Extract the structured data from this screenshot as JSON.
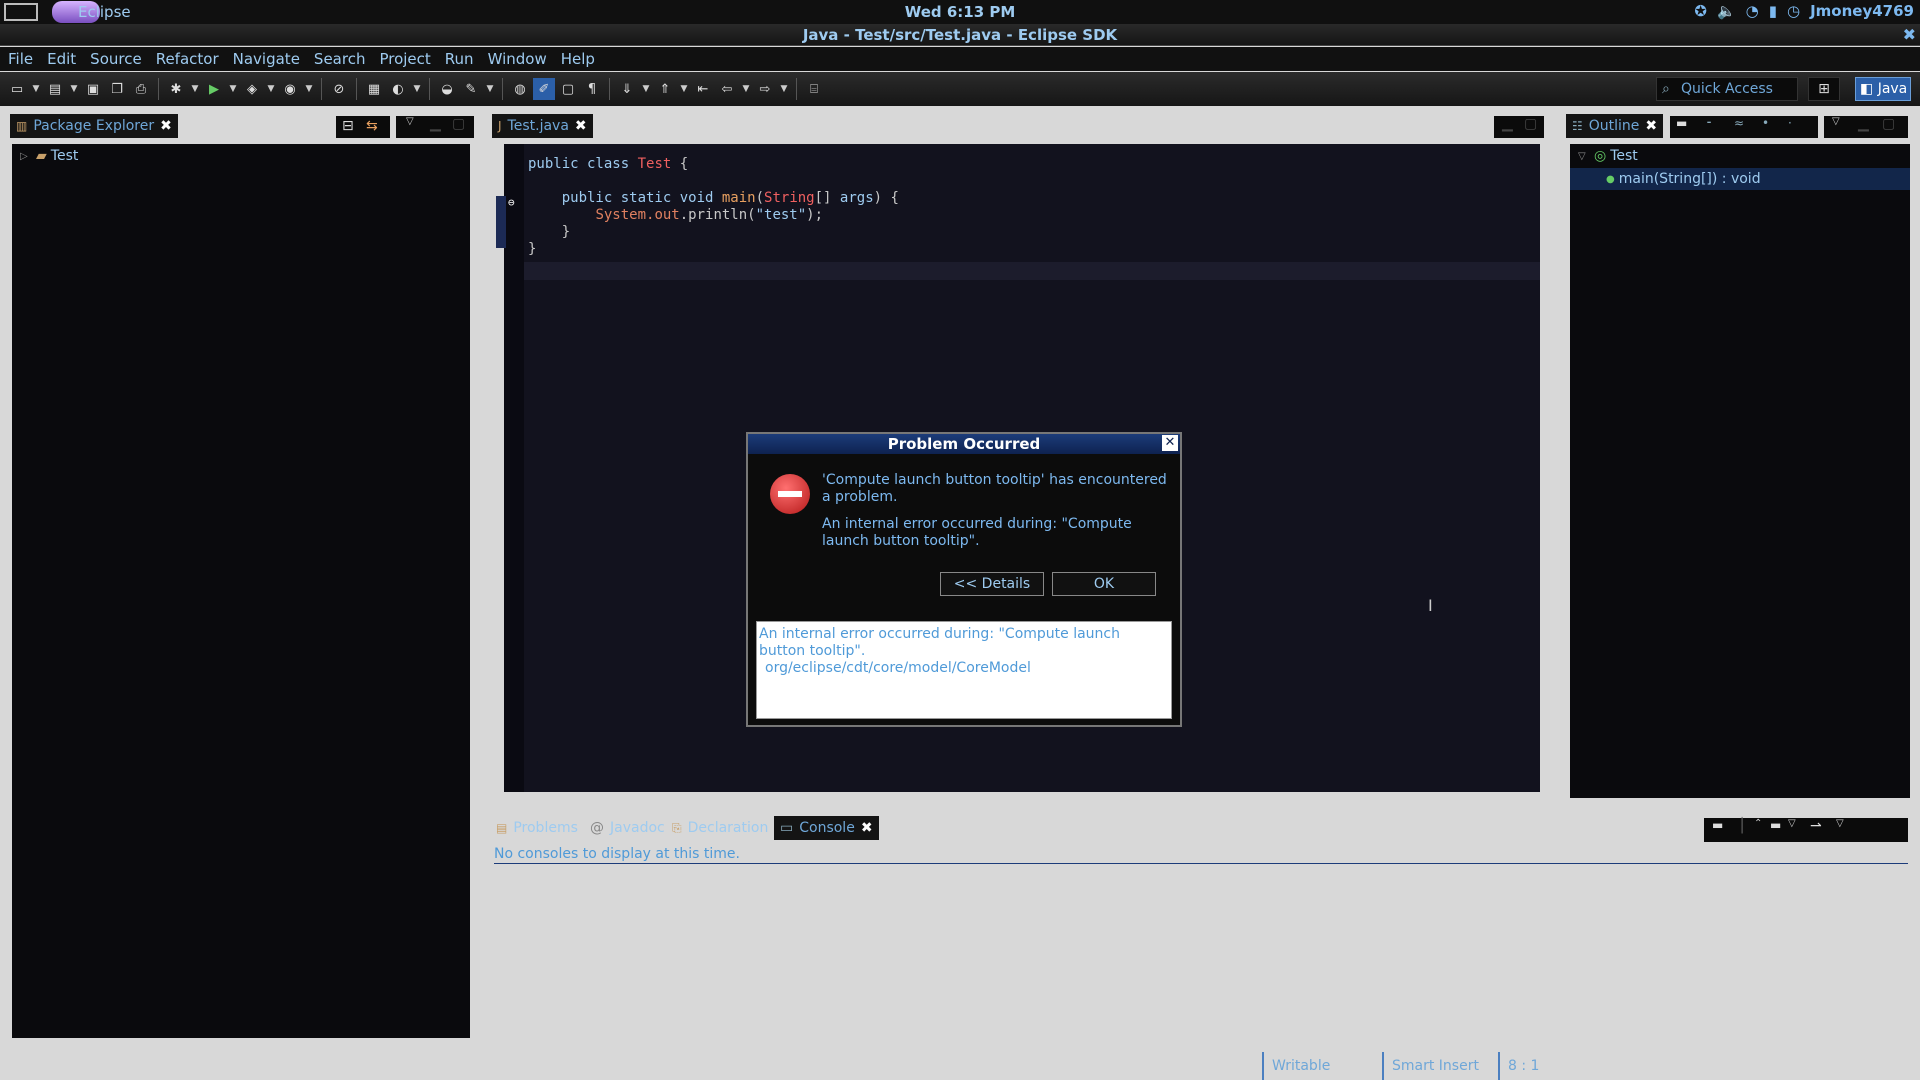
{
  "system_bar": {
    "app_label": "Eclipse",
    "clock": "Wed  6:13 PM",
    "user": "Jmoney4769",
    "tray_icons": [
      "accessibility-icon",
      "volume-icon",
      "wifi-icon",
      "battery-icon",
      "user-icon"
    ]
  },
  "window": {
    "title": "Java - Test/src/Test.java - Eclipse SDK"
  },
  "menu": [
    "File",
    "Edit",
    "Source",
    "Refactor",
    "Navigate",
    "Search",
    "Project",
    "Run",
    "Window",
    "Help"
  ],
  "toolbar": {
    "quick_access_placeholder": "Quick Access",
    "perspective_label": "Java"
  },
  "package_explorer": {
    "tab_label": "Package Explorer",
    "items": [
      {
        "label": "Test"
      }
    ]
  },
  "editor": {
    "tab_label": "Test.java",
    "code_lines": [
      "public class Test {",
      "",
      "    public static void main(String[] args) {",
      "        System.out.println(\"test\");",
      "    }",
      "}"
    ]
  },
  "outline": {
    "tab_label": "Outline",
    "items": [
      {
        "label": "Test"
      },
      {
        "label": "main(String[]) : void"
      }
    ]
  },
  "bottom_panel": {
    "tabs": [
      "Problems",
      "Javadoc",
      "Declaration",
      "Console"
    ],
    "active_tab": "Console",
    "message": "No consoles to display at this time."
  },
  "dialog": {
    "title": "Problem Occurred",
    "message_line1": "'Compute launch button tooltip' has encountered a problem.",
    "message_line2": "An internal error occurred during: \"Compute launch button tooltip\".",
    "details_button": "<< Details",
    "ok_button": "OK",
    "details_text_1": "An internal error occurred during: \"Compute launch button tooltip\".",
    "details_text_2": "org/eclipse/cdt/core/model/CoreModel"
  },
  "status_bar": {
    "writable": "Writable",
    "insert_mode": "Smart Insert",
    "position": "8 : 1"
  }
}
